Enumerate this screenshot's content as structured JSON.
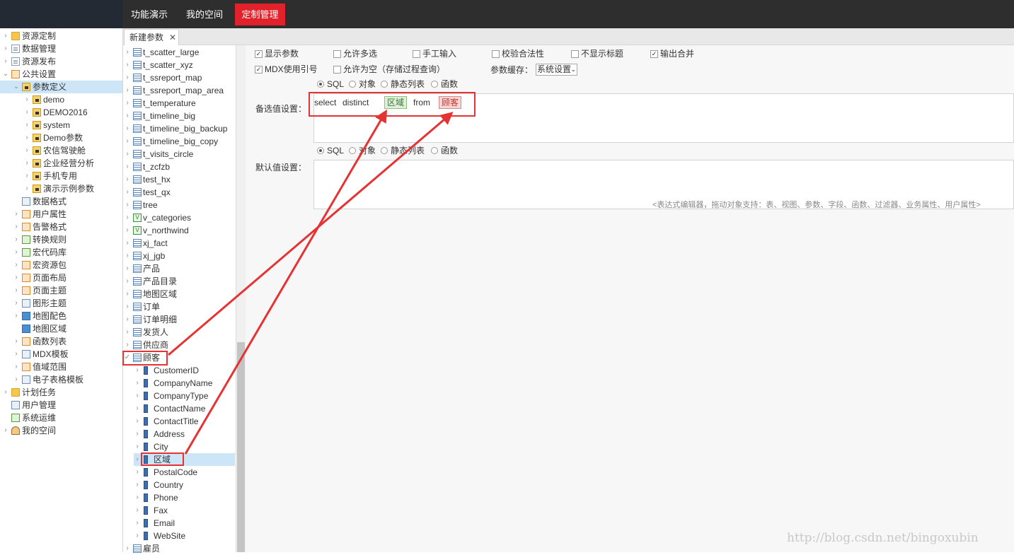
{
  "topnav": {
    "items": [
      "功能演示",
      "我的空间",
      "定制管理"
    ],
    "active": "定制管理",
    "active_color": "#e1222b"
  },
  "left_tree": {
    "items": [
      {
        "label": "资源定制",
        "icon": "folder-icon",
        "arrow": "›"
      },
      {
        "label": "数据管理",
        "icon": "database-icon",
        "arrow": "›"
      },
      {
        "label": "资源发布",
        "icon": "publish-icon",
        "arrow": "›"
      },
      {
        "label": "公共设置",
        "icon": "settings-icon",
        "arrow": "⌄"
      },
      {
        "label": "参数定义",
        "icon": "parameter-icon",
        "arrow": "⌄"
      },
      {
        "label": "demo",
        "icon": "parameter-icon",
        "arrow": "›"
      },
      {
        "label": "DEMO2016",
        "icon": "parameter-icon",
        "arrow": "›"
      },
      {
        "label": "system",
        "icon": "parameter-icon",
        "arrow": "›"
      },
      {
        "label": "Demo参数",
        "icon": "parameter-icon",
        "arrow": "›"
      },
      {
        "label": "农信驾驶舱",
        "icon": "parameter-icon",
        "arrow": "›"
      },
      {
        "label": "企业经营分析",
        "icon": "parameter-icon",
        "arrow": "›"
      },
      {
        "label": "手机专用",
        "icon": "parameter-icon",
        "arrow": "›"
      },
      {
        "label": "演示示例参数",
        "icon": "parameter-icon",
        "arrow": "›"
      },
      {
        "label": "数据格式",
        "icon": "format-icon",
        "arrow": ""
      },
      {
        "label": "用户属性",
        "icon": "user-attr-icon",
        "arrow": "›"
      },
      {
        "label": "告警格式",
        "icon": "alert-icon",
        "arrow": "›"
      },
      {
        "label": "转换规则",
        "icon": "convert-icon",
        "arrow": "›"
      },
      {
        "label": "宏代码库",
        "icon": "macro-icon",
        "arrow": "›"
      },
      {
        "label": "宏资源包",
        "icon": "macro-package-icon",
        "arrow": "›"
      },
      {
        "label": "页面布局",
        "icon": "layout-icon",
        "arrow": "›"
      },
      {
        "label": "页面主题",
        "icon": "theme-icon",
        "arrow": "›"
      },
      {
        "label": "图形主题",
        "icon": "chart-theme-icon",
        "arrow": "›"
      },
      {
        "label": "地图配色",
        "icon": "map-color-icon",
        "arrow": "›"
      },
      {
        "label": "地图区域",
        "icon": "map-region-icon",
        "arrow": ""
      },
      {
        "label": "函数列表",
        "icon": "function-icon",
        "arrow": "›"
      },
      {
        "label": "MDX模板",
        "icon": "mdx-icon",
        "arrow": "›"
      },
      {
        "label": "值域范围",
        "icon": "range-icon",
        "arrow": "›"
      },
      {
        "label": "电子表格模板",
        "icon": "spreadsheet-icon",
        "arrow": "›"
      },
      {
        "label": "计划任务",
        "icon": "schedule-icon",
        "arrow": "›"
      },
      {
        "label": "用户管理",
        "icon": "user-mgmt-icon",
        "arrow": ""
      },
      {
        "label": "系统运维",
        "icon": "ops-icon",
        "arrow": ""
      },
      {
        "label": "我的空间",
        "icon": "my-space-icon",
        "arrow": "›"
      }
    ],
    "selected": "参数定义"
  },
  "tab": {
    "label": "新建参数",
    "close": "✕"
  },
  "resource_tree": {
    "tables": [
      {
        "label": "t_scatter_large",
        "icon": "table-icon"
      },
      {
        "label": "t_scatter_xyz",
        "icon": "table-icon"
      },
      {
        "label": "t_ssreport_map",
        "icon": "table-icon"
      },
      {
        "label": "t_ssreport_map_area",
        "icon": "table-icon"
      },
      {
        "label": "t_temperature",
        "icon": "table-icon"
      },
      {
        "label": "t_timeline_big",
        "icon": "table-icon"
      },
      {
        "label": "t_timeline_big_backup",
        "icon": "table-icon"
      },
      {
        "label": "t_timeline_big_copy",
        "icon": "table-icon"
      },
      {
        "label": "t_visits_circle",
        "icon": "table-icon"
      },
      {
        "label": "t_zcfzb",
        "icon": "table-icon"
      },
      {
        "label": "test_hx",
        "icon": "table-icon"
      },
      {
        "label": "test_qx",
        "icon": "table-icon"
      },
      {
        "label": "tree",
        "icon": "table-icon"
      },
      {
        "label": "v_categories",
        "icon": "view-icon"
      },
      {
        "label": "v_northwind",
        "icon": "view-icon"
      },
      {
        "label": "xj_fact",
        "icon": "table-icon"
      },
      {
        "label": "xj_jgb",
        "icon": "table-icon"
      },
      {
        "label": "产品",
        "icon": "table-icon"
      },
      {
        "label": "产品目录",
        "icon": "table-icon"
      },
      {
        "label": "地图区域",
        "icon": "table-icon"
      },
      {
        "label": "订单",
        "icon": "table-icon"
      },
      {
        "label": "订单明细",
        "icon": "table-icon"
      },
      {
        "label": "发货人",
        "icon": "table-icon"
      },
      {
        "label": "供应商",
        "icon": "table-icon"
      },
      {
        "label": "顾客",
        "icon": "table-icon",
        "expanded": true
      }
    ],
    "fields": [
      "CustomerID",
      "CompanyName",
      "CompanyType",
      "ContactName",
      "ContactTitle",
      "Address",
      "City",
      "区域",
      "PostalCode",
      "Country",
      "Phone",
      "Fax",
      "Email",
      "WebSite"
    ],
    "selected_field": "区域",
    "after": [
      {
        "label": "雇员",
        "icon": "table-icon"
      }
    ],
    "arrow_collapsed": "›",
    "arrow_expanded": "✓"
  },
  "options": {
    "row1": [
      {
        "label": "显示参数",
        "checked": true
      },
      {
        "label": "允许多选",
        "checked": false
      },
      {
        "label": "手工输入",
        "checked": false
      },
      {
        "label": "校验合法性",
        "checked": false
      },
      {
        "label": "不显示标题",
        "checked": false
      },
      {
        "label": "输出合并",
        "checked": true
      }
    ],
    "row2": [
      {
        "label": "MDX使用引号",
        "checked": true
      },
      {
        "label": "允许为空（存储过程查询）",
        "checked": false
      }
    ],
    "cache_label": "参数缓存：",
    "cache_value": "系统设置",
    "cache_arrow": "⌄",
    "check_mark": "✓"
  },
  "candidate": {
    "label": "备选值设置：",
    "radios": [
      "SQL",
      "对象",
      "静态列表",
      "函数"
    ],
    "selected": "SQL",
    "tokens": {
      "select": "select",
      "distinct": "distinct",
      "field": "区域",
      "from": "from",
      "table": "顾客"
    }
  },
  "default_value": {
    "label": "默认值设置：",
    "radios": [
      "SQL",
      "对象",
      "静态列表",
      "函数"
    ],
    "selected": "SQL"
  },
  "hint": "<表达式编辑器，拖动对象支持：表、视图、参数、字段、函数、过滤器、业务属性、用户属性>",
  "watermark": "http://blog.csdn.net/bingoxubin",
  "colors": {
    "annotation_red": "#e53333",
    "selection_blue": "#cde6f7"
  }
}
